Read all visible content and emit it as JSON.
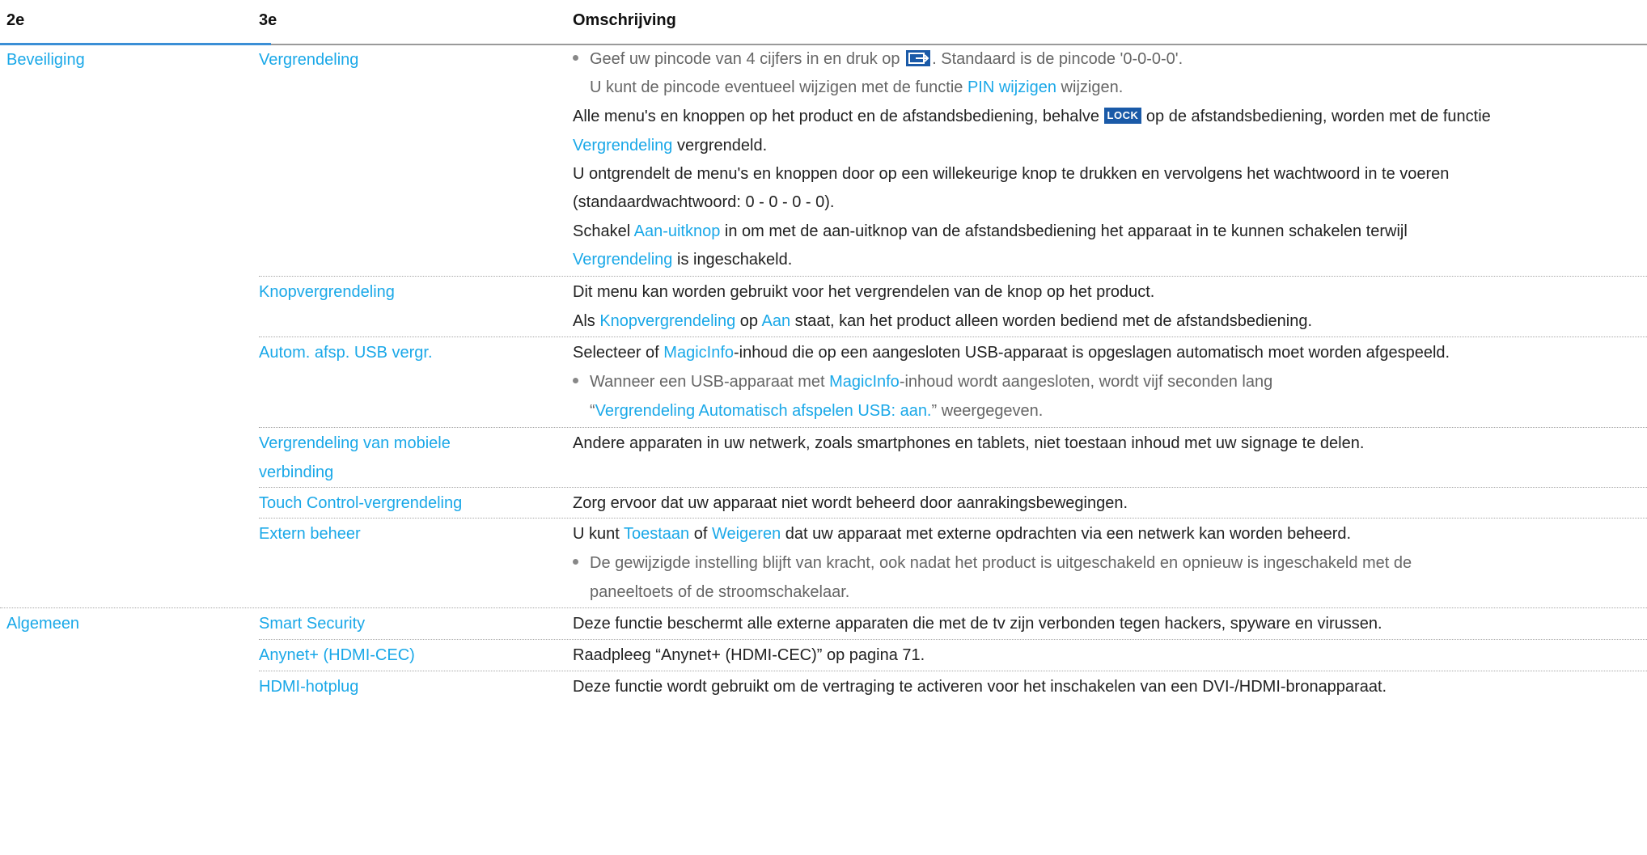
{
  "header": {
    "col1": "2e",
    "col2": "3e",
    "col3": "Omschrijving"
  },
  "sec_beveiliging": {
    "title": "Beveiliging",
    "vergrendeling": {
      "name": "Vergrendeling",
      "b1_a": "Geef uw pincode van 4 cijfers in en druk op ",
      "b1_b": ". Standaard is de pincode '0-0-0-0'.",
      "b1_c": "U kunt de pincode eventueel wijzigen met de functie ",
      "b1_link": "PIN wijzigen",
      "b1_d": " wijzigen.",
      "p1_a": "Alle menu's en knoppen op het product en de afstandsbediening, behalve ",
      "p1_badge": "LOCK",
      "p1_b": " op de afstandsbediening, worden met de functie",
      "p1_link": "Vergrendeling",
      "p1_c": " vergrendeld.",
      "p2_a": "U ontgrendelt de menu's en knoppen door op een willekeurige knop te drukken en vervolgens het wachtwoord in te voeren",
      "p2_b": "(standaardwachtwoord: 0 - 0 - 0 - 0).",
      "p3_a": "Schakel ",
      "p3_link1": "Aan-uitknop",
      "p3_b": " in om met de aan-uitknop van de afstandsbediening het apparaat in te kunnen schakelen terwijl",
      "p3_link2": "Vergrendeling",
      "p3_c": " is ingeschakeld."
    },
    "knop": {
      "name": "Knopvergrendeling",
      "p1": "Dit menu kan worden gebruikt voor het vergrendelen van de knop op het product.",
      "p2_a": "Als ",
      "p2_link1": "Knopvergrendeling",
      "p2_b": " op ",
      "p2_link2": "Aan",
      "p2_c": " staat, kan het product alleen worden bediend met de afstandsbediening."
    },
    "usb": {
      "name": "Autom. afsp. USB vergr.",
      "p1_a": "Selecteer of ",
      "p1_link": "MagicInfo",
      "p1_b": "-inhoud die op een aangesloten USB-apparaat is opgeslagen automatisch moet worden afgespeeld.",
      "b1_a": "Wanneer een USB-apparaat met ",
      "b1_link": "MagicInfo",
      "b1_b": "-inhoud wordt aangesloten, wordt vijf seconden lang",
      "b1_c": "“",
      "b1_link2": "Vergrendeling Automatisch afspelen USB: aan.",
      "b1_d": "” weergegeven."
    },
    "mobiel": {
      "name_1": "Vergrendeling van mobiele",
      "name_2": "verbinding",
      "p1": "Andere apparaten in uw netwerk, zoals smartphones en tablets, niet toestaan inhoud met uw signage te delen."
    },
    "touch": {
      "name": "Touch Control-vergrendeling",
      "p1": "Zorg ervoor dat uw apparaat niet wordt beheerd door aanrakingsbewegingen."
    },
    "extern": {
      "name": "Extern beheer",
      "p1_a": "U kunt ",
      "p1_link1": "Toestaan",
      "p1_b": " of ",
      "p1_link2": "Weigeren",
      "p1_c": " dat uw apparaat met externe opdrachten via een netwerk kan worden beheerd.",
      "b1_a": "De gewijzigde instelling blijft van kracht, ook nadat het product is uitgeschakeld en opnieuw is ingeschakeld met de",
      "b1_b": "paneeltoets of de stroomschakelaar."
    }
  },
  "sec_algemeen": {
    "title": "Algemeen",
    "smart": {
      "name": "Smart Security",
      "p1": "Deze functie beschermt alle externe apparaten die met de tv zijn verbonden tegen hackers, spyware en virussen."
    },
    "anynet": {
      "name": "Anynet+ (HDMI-CEC)",
      "p1": "Raadpleeg “Anynet+ (HDMI-CEC)” op pagina 71."
    },
    "hotplug": {
      "name": "HDMI-hotplug",
      "p1": "Deze functie wordt gebruikt om de vertraging te activeren voor het inschakelen van een DVI-/HDMI-bronapparaat."
    }
  }
}
